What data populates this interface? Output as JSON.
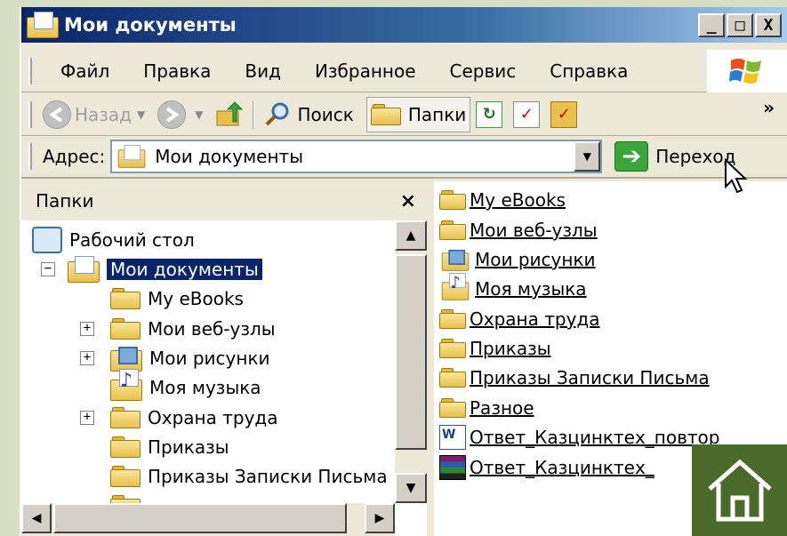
{
  "window": {
    "title": "Мои документы"
  },
  "title_buttons": {
    "minimize": "_",
    "maximize": "□",
    "close": "X"
  },
  "menu": [
    "Файл",
    "Правка",
    "Вид",
    "Избранное",
    "Сервис",
    "Справка"
  ],
  "toolbar": {
    "back": "Назад",
    "search": "Поиск",
    "folders": "Папки",
    "more": "»"
  },
  "address": {
    "label": "Адрес:",
    "value": "Мои документы",
    "go": "Переход"
  },
  "folder_pane": {
    "title": "Папки",
    "close": "×",
    "tree": [
      {
        "label": "Рабочий стол",
        "icon": "desktop-icon",
        "depth": 0,
        "expander": ""
      },
      {
        "label": "Мои документы",
        "icon": "my-documents-icon",
        "depth": 1,
        "expander": "−",
        "selected": true
      },
      {
        "label": "My eBooks",
        "icon": "folder-icon",
        "depth": 2,
        "expander": ""
      },
      {
        "label": "Мои веб-узлы",
        "icon": "folder-icon",
        "depth": 2,
        "expander": "+"
      },
      {
        "label": "Мои рисунки",
        "icon": "pictures-folder-icon",
        "depth": 2,
        "expander": "+"
      },
      {
        "label": "Моя музыка",
        "icon": "music-folder-icon",
        "depth": 2,
        "expander": ""
      },
      {
        "label": "Охрана труда",
        "icon": "folder-icon",
        "depth": 2,
        "expander": "+"
      },
      {
        "label": "Приказы",
        "icon": "folder-icon",
        "depth": 2,
        "expander": ""
      },
      {
        "label": "Приказы Записки Письма",
        "icon": "folder-icon",
        "depth": 2,
        "expander": ""
      }
    ]
  },
  "content": {
    "items": [
      {
        "label": "My eBooks",
        "icon": "folder-icon"
      },
      {
        "label": "Мои веб-узлы",
        "icon": "folder-icon"
      },
      {
        "label": "Мои рисунки",
        "icon": "pictures-folder-icon"
      },
      {
        "label": "Моя музыка",
        "icon": "music-folder-icon"
      },
      {
        "label": "Охрана труда",
        "icon": "folder-icon"
      },
      {
        "label": "Приказы",
        "icon": "folder-icon"
      },
      {
        "label": "Приказы Записки Письма",
        "icon": "folder-icon"
      },
      {
        "label": "Разное",
        "icon": "folder-icon"
      },
      {
        "label": "Ответ_Казцинктех_повтор",
        "icon": "word-doc-icon"
      },
      {
        "label": "Ответ_Казцинктех_",
        "icon": "rar-archive-icon"
      }
    ]
  },
  "colors": {
    "title_bar": "#0a246a",
    "selection": "#0a246a",
    "home_button": "#4a6a2a",
    "window_bg": "#ece9d8"
  }
}
